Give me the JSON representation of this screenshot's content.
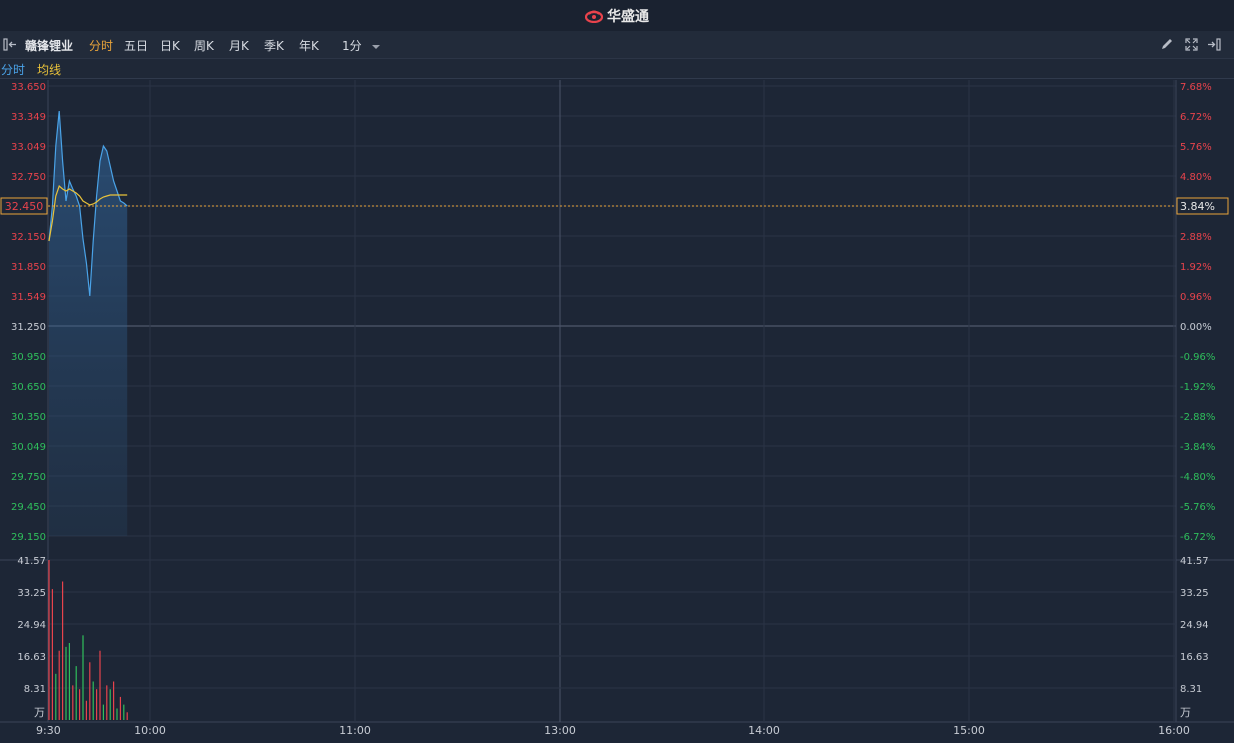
{
  "app": {
    "title": "华盛通",
    "colors": {
      "up": "#e8434c",
      "down": "#2fbf5c",
      "accent": "#e9a43a",
      "price_line": "#4aa3e8",
      "avg_line": "#e9c23a",
      "background": "#1d2636"
    }
  },
  "toolbar": {
    "left_icon": "collapse-left-icon",
    "stock_name": "赣锋锂业",
    "tabs": [
      {
        "label": "分时",
        "active": true
      },
      {
        "label": "五日",
        "active": false
      },
      {
        "label": "日K",
        "active": false
      },
      {
        "label": "周K",
        "active": false
      },
      {
        "label": "月K",
        "active": false
      },
      {
        "label": "季K",
        "active": false
      },
      {
        "label": "年K",
        "active": false
      }
    ],
    "interval": "1分",
    "right_icons": [
      "pencil-icon",
      "expand-icon",
      "collapse-right-icon"
    ]
  },
  "legend": {
    "price_label": "分时",
    "avg_label": "均线"
  },
  "chart_data": {
    "type": "line",
    "prev_close": 31.25,
    "current_price": "32.450",
    "current_pct": "3.84%",
    "price_ticks": [
      "33.650",
      "33.349",
      "33.049",
      "32.750",
      "32.450",
      "32.150",
      "31.850",
      "31.549",
      "31.250",
      "30.950",
      "30.650",
      "30.350",
      "30.049",
      "29.750",
      "29.450",
      "29.150"
    ],
    "pct_ticks": [
      "7.68%",
      "6.72%",
      "5.76%",
      "4.80%",
      "3.84%",
      "2.88%",
      "1.92%",
      "0.96%",
      "0.00%",
      "-0.96%",
      "-1.92%",
      "-2.88%",
      "-3.84%",
      "-4.80%",
      "-5.76%",
      "-6.72%"
    ],
    "ylim": [
      28.85,
      33.65
    ],
    "x_time_labels": [
      "9:30",
      "10:00",
      "11:00",
      "13:00",
      "14:00",
      "15:00",
      "16:00"
    ],
    "series": [
      {
        "name": "分时",
        "x": [
          0,
          1,
          2,
          3,
          4,
          5,
          6,
          7,
          8,
          9,
          10,
          11,
          12,
          13,
          14,
          15,
          16,
          17,
          18,
          19,
          20,
          21,
          22,
          23
        ],
        "values": [
          32.1,
          32.45,
          33.05,
          33.4,
          32.9,
          32.5,
          32.7,
          32.62,
          32.55,
          32.45,
          32.12,
          31.88,
          31.55,
          32.1,
          32.55,
          32.9,
          33.05,
          33.0,
          32.85,
          32.7,
          32.6,
          32.5,
          32.48,
          32.45
        ]
      },
      {
        "name": "均线",
        "x": [
          0,
          1,
          2,
          3,
          4,
          5,
          6,
          7,
          8,
          9,
          10,
          11,
          12,
          13,
          14,
          15,
          16,
          17,
          18,
          19,
          20,
          21,
          22,
          23
        ],
        "values": [
          32.1,
          32.3,
          32.55,
          32.65,
          32.62,
          32.6,
          32.62,
          32.6,
          32.58,
          32.55,
          32.5,
          32.48,
          32.46,
          32.47,
          32.49,
          32.52,
          32.54,
          32.55,
          32.56,
          32.56,
          32.56,
          32.56,
          32.56,
          32.56
        ]
      }
    ],
    "volume": {
      "unit": "万",
      "ticks": [
        "41.57",
        "33.25",
        "24.94",
        "16.63",
        "8.31"
      ],
      "ylim": [
        0,
        41.57
      ],
      "values": [
        41.57,
        34.0,
        12.0,
        18.0,
        36.0,
        19.0,
        20.0,
        9.0,
        14.0,
        8.0,
        22.0,
        5.0,
        15.0,
        10.0,
        8.0,
        18.0,
        4.0,
        9.0,
        8.0,
        10.0,
        3.0,
        6.0,
        4.0,
        2.0
      ],
      "colors": [
        "up",
        "up",
        "down",
        "up",
        "up",
        "down",
        "down",
        "up",
        "down",
        "up",
        "down",
        "up",
        "up",
        "down",
        "up",
        "up",
        "down",
        "up",
        "down",
        "up",
        "down",
        "up",
        "down",
        "up"
      ]
    }
  }
}
